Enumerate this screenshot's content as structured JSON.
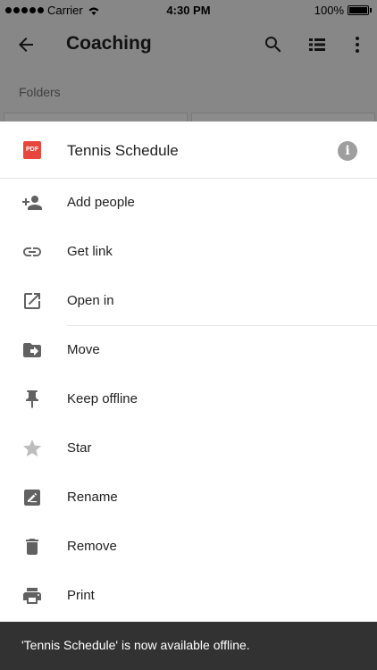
{
  "status_bar": {
    "carrier": "Carrier",
    "time": "4:30 PM",
    "battery": "100%"
  },
  "app_bar": {
    "title": "Coaching"
  },
  "background": {
    "section_label": "Folders"
  },
  "sheet": {
    "file_type_badge": "PDF",
    "file_name": "Tennis Schedule",
    "info_glyph": "i",
    "items": [
      {
        "label": "Add people",
        "icon": "add-person-icon"
      },
      {
        "label": "Get link",
        "icon": "link-icon"
      },
      {
        "label": "Open in",
        "icon": "open-in-new-icon"
      },
      {
        "label": "Move",
        "icon": "move-folder-icon"
      },
      {
        "label": "Keep offline",
        "icon": "pin-icon"
      },
      {
        "label": "Star",
        "icon": "star-icon"
      },
      {
        "label": "Rename",
        "icon": "rename-icon"
      },
      {
        "label": "Remove",
        "icon": "trash-icon"
      },
      {
        "label": "Print",
        "icon": "print-icon"
      }
    ]
  },
  "snackbar": {
    "message": "'Tennis Schedule' is now available offline."
  },
  "colors": {
    "pdf_red": "#e8453c",
    "icon_gray": "#616161",
    "snackbar_bg": "#323232"
  }
}
